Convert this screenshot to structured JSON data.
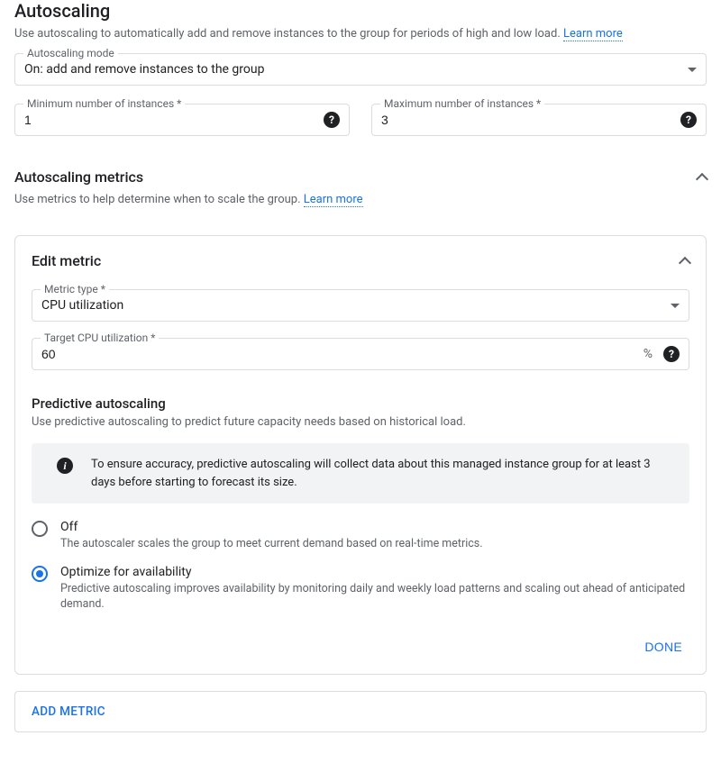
{
  "autoscaling": {
    "title": "Autoscaling",
    "desc": "Use autoscaling to automatically add and remove instances to the group for periods of high and low load. ",
    "learn_more": "Learn more",
    "mode": {
      "label": "Autoscaling mode",
      "value": "On: add and remove instances to the group"
    },
    "min": {
      "label": "Minimum number of instances *",
      "value": "1"
    },
    "max": {
      "label": "Maximum number of instances *",
      "value": "3"
    }
  },
  "metrics": {
    "title": "Autoscaling metrics",
    "desc": "Use metrics to help determine when to scale the group. ",
    "learn_more": "Learn more"
  },
  "edit_metric": {
    "title": "Edit metric",
    "type": {
      "label": "Metric type *",
      "value": "CPU utilization"
    },
    "target": {
      "label": "Target CPU utilization *",
      "value": "60",
      "suffix": "%"
    },
    "predictive": {
      "title": "Predictive autoscaling",
      "desc": "Use predictive autoscaling to predict future capacity needs based on historical load.",
      "info": "To ensure accuracy, predictive autoscaling will collect data about this managed instance group for at least 3 days before starting to forecast its size.",
      "options": [
        {
          "label": "Off",
          "sub": "The autoscaler scales the group to meet current demand based on real-time metrics.",
          "checked": false
        },
        {
          "label": "Optimize for availability",
          "sub": "Predictive autoscaling improves availability by monitoring daily and weekly load patterns and scaling out ahead of anticipated demand.",
          "checked": true
        }
      ]
    },
    "done": "DONE"
  },
  "add_metric": "ADD METRIC"
}
